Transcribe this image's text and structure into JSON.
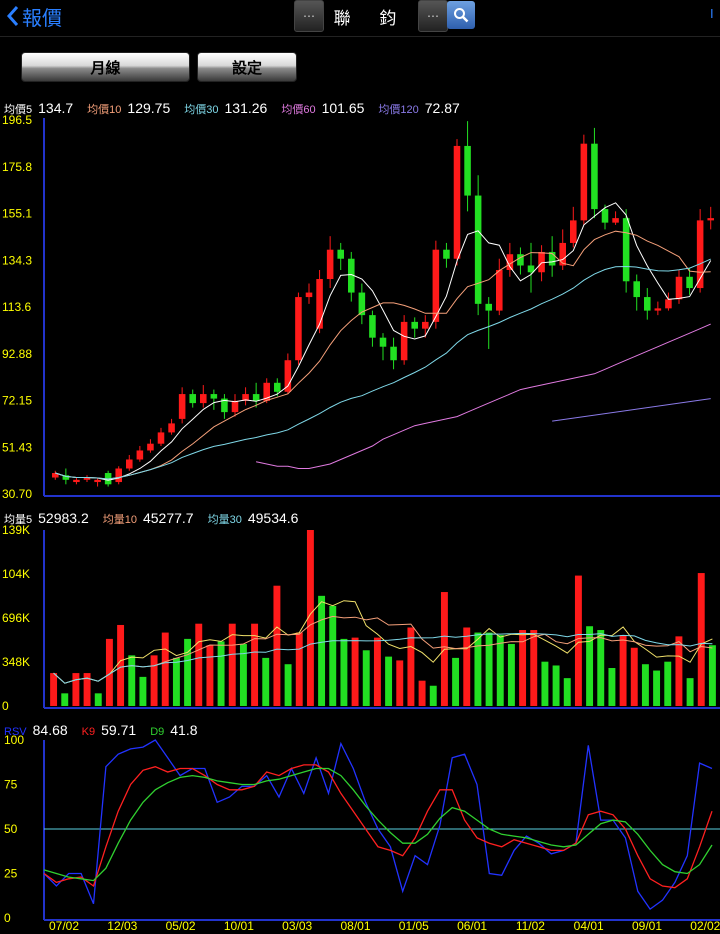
{
  "header": {
    "back_label": "報價",
    "title": "聯 鈞",
    "prev_icon": "⋯",
    "next_icon": "⋯",
    "corner_label": "I"
  },
  "buttons": {
    "period": "月線",
    "settings": "設定"
  },
  "colors": {
    "up": "#ff1a1a",
    "down": "#22e022",
    "ma5": "#ffffff",
    "ma10": "#f5a07a",
    "ma30": "#7fd8e8",
    "ma60": "#e07ae0",
    "ma120": "#8a7ae8",
    "vol5": "#f0e06a",
    "vol10": "#f5a07a",
    "vol30": "#7fd8e8",
    "rsv": "#2233ff",
    "k9": "#ff2020",
    "d9": "#30d030",
    "axis": "#2233cc",
    "tick": "#ffff00"
  },
  "price_legend": [
    {
      "label": "均價5",
      "value": "134.7",
      "color": "#ffffff"
    },
    {
      "label": "均價10",
      "value": "129.75",
      "color": "#f5a07a"
    },
    {
      "label": "均價30",
      "value": "131.26",
      "color": "#7fd8e8"
    },
    {
      "label": "均價60",
      "value": "101.65",
      "color": "#e07ae0"
    },
    {
      "label": "均價120",
      "value": "72.87",
      "color": "#8a7ae8"
    }
  ],
  "volume_legend": [
    {
      "label": "均量5",
      "value": "52983.2",
      "color": "#ffffff"
    },
    {
      "label": "均量10",
      "value": "45277.7",
      "color": "#f5a07a"
    },
    {
      "label": "均量30",
      "value": "49534.6",
      "color": "#7fd8e8"
    }
  ],
  "kd_legend": [
    {
      "label": "RSV",
      "value": "84.68",
      "color": "#2233ff"
    },
    {
      "label": "K9",
      "value": "59.71",
      "color": "#ff2020"
    },
    {
      "label": "D9",
      "value": "41.8",
      "color": "#30d030"
    }
  ],
  "chart_data": [
    {
      "type": "candlestick",
      "ylim": [
        30.7,
        196.5
      ],
      "yticks": [
        "196.5",
        "175.8",
        "155.1",
        "134.3",
        "113.6",
        "92.88",
        "72.15",
        "51.43",
        "30.70"
      ],
      "xticks": [
        "07/02",
        "12/03",
        "05/02",
        "10/01",
        "03/03",
        "08/01",
        "01/05",
        "06/01",
        "11/02",
        "04/01",
        "09/01",
        "02/02"
      ],
      "candles": [
        [
          38,
          40,
          37,
          41
        ],
        [
          39,
          37,
          35,
          42
        ],
        [
          36,
          37,
          35,
          38
        ],
        [
          37,
          38,
          36,
          39
        ],
        [
          36,
          37,
          34,
          38
        ],
        [
          40,
          35,
          34,
          41
        ],
        [
          36,
          42,
          35,
          43
        ],
        [
          42,
          46,
          41,
          48
        ],
        [
          46,
          50,
          45,
          52
        ],
        [
          50,
          53,
          49,
          55
        ],
        [
          53,
          58,
          52,
          60
        ],
        [
          58,
          62,
          57,
          64
        ],
        [
          64,
          75,
          62,
          78
        ],
        [
          75,
          71,
          69,
          77
        ],
        [
          71,
          75,
          69,
          79
        ],
        [
          75,
          73,
          68,
          77
        ],
        [
          73,
          67,
          64,
          75
        ],
        [
          67,
          72,
          65,
          75
        ],
        [
          72,
          75,
          70,
          78
        ],
        [
          75,
          72,
          69,
          80
        ],
        [
          72,
          80,
          71,
          82
        ],
        [
          80,
          76,
          74,
          82
        ],
        [
          76,
          90,
          75,
          93
        ],
        [
          90,
          118,
          88,
          120
        ],
        [
          118,
          120,
          115,
          124
        ],
        [
          104,
          126,
          102,
          130
        ],
        [
          126,
          139,
          122,
          145
        ],
        [
          139,
          135,
          130,
          142
        ],
        [
          135,
          120,
          116,
          138
        ],
        [
          120,
          110,
          106,
          124
        ],
        [
          110,
          100,
          96,
          112
        ],
        [
          100,
          96,
          90,
          102
        ],
        [
          96,
          90,
          86,
          100
        ],
        [
          90,
          107,
          88,
          110
        ],
        [
          107,
          104,
          100,
          109
        ],
        [
          104,
          107,
          100,
          110
        ],
        [
          107,
          139,
          104,
          143
        ],
        [
          139,
          135,
          131,
          142
        ],
        [
          135,
          185,
          132,
          188
        ],
        [
          185,
          163,
          156,
          196
        ],
        [
          163,
          115,
          110,
          172
        ],
        [
          115,
          112,
          95,
          118
        ],
        [
          112,
          130,
          110,
          135
        ],
        [
          130,
          137,
          127,
          142
        ],
        [
          137,
          132,
          128,
          140
        ],
        [
          132,
          129,
          120,
          142
        ],
        [
          129,
          138,
          125,
          141
        ],
        [
          138,
          132,
          127,
          145
        ],
        [
          132,
          142,
          130,
          148
        ],
        [
          142,
          152,
          140,
          158
        ],
        [
          152,
          186,
          150,
          190
        ],
        [
          186,
          157,
          153,
          193
        ],
        [
          157,
          151,
          148,
          159
        ],
        [
          151,
          153,
          150,
          156
        ],
        [
          153,
          125,
          120,
          157
        ],
        [
          125,
          118,
          112,
          128
        ],
        [
          118,
          112,
          108,
          122
        ],
        [
          112,
          113,
          110,
          116
        ],
        [
          113,
          117,
          112,
          120
        ],
        [
          117,
          127,
          115,
          130
        ],
        [
          127,
          122,
          119,
          131
        ],
        [
          122,
          152,
          120,
          157
        ],
        [
          152,
          153,
          148,
          158
        ]
      ]
    },
    {
      "type": "bar",
      "ylim": [
        0,
        139000
      ],
      "yticks": [
        "139K",
        "104K",
        "696K",
        "348K",
        "0"
      ],
      "volumes": [
        [
          26000,
          1
        ],
        [
          10000,
          0
        ],
        [
          26000,
          1
        ],
        [
          26000,
          1
        ],
        [
          10000,
          0
        ],
        [
          53000,
          1
        ],
        [
          64000,
          1
        ],
        [
          40000,
          0
        ],
        [
          23000,
          0
        ],
        [
          40000,
          1
        ],
        [
          58000,
          1
        ],
        [
          38000,
          0
        ],
        [
          53000,
          0
        ],
        [
          65000,
          1
        ],
        [
          48000,
          1
        ],
        [
          51000,
          0
        ],
        [
          65000,
          1
        ],
        [
          49000,
          0
        ],
        [
          65000,
          1
        ],
        [
          38000,
          0
        ],
        [
          95000,
          1
        ],
        [
          33000,
          0
        ],
        [
          58000,
          1
        ],
        [
          139000,
          1
        ],
        [
          87000,
          0
        ],
        [
          79000,
          0
        ],
        [
          53000,
          0
        ],
        [
          54000,
          1
        ],
        [
          44000,
          0
        ],
        [
          54000,
          1
        ],
        [
          39000,
          0
        ],
        [
          36000,
          1
        ],
        [
          62000,
          1
        ],
        [
          20000,
          1
        ],
        [
          16000,
          0
        ],
        [
          90000,
          1
        ],
        [
          38000,
          0
        ],
        [
          62000,
          1
        ],
        [
          58000,
          0
        ],
        [
          58000,
          0
        ],
        [
          56000,
          0
        ],
        [
          49000,
          0
        ],
        [
          60000,
          1
        ],
        [
          60000,
          1
        ],
        [
          35000,
          0
        ],
        [
          32000,
          0
        ],
        [
          22000,
          0
        ],
        [
          103000,
          1
        ],
        [
          63000,
          0
        ],
        [
          60000,
          0
        ],
        [
          30000,
          0
        ],
        [
          56000,
          1
        ],
        [
          46000,
          1
        ],
        [
          33000,
          0
        ],
        [
          28000,
          0
        ],
        [
          35000,
          0
        ],
        [
          55000,
          1
        ],
        [
          22000,
          0
        ],
        [
          105000,
          1
        ],
        [
          48000,
          0
        ]
      ]
    },
    {
      "type": "line",
      "ylim": [
        0,
        100
      ],
      "yticks": [
        "100",
        "75",
        "50",
        "25",
        "0"
      ],
      "series": [
        {
          "name": "RSV",
          "values": [
            25,
            18,
            25,
            25,
            8,
            85,
            92,
            95,
            96,
            100,
            90,
            80,
            84,
            84,
            65,
            68,
            74,
            74,
            80,
            68,
            84,
            70,
            90,
            70,
            98,
            84,
            65,
            50,
            40,
            15,
            35,
            30,
            52,
            90,
            92,
            75,
            25,
            24,
            38,
            46,
            42,
            36,
            38,
            42,
            97,
            55,
            55,
            45,
            15,
            5,
            10,
            20,
            35,
            87,
            84
          ]
        },
        {
          "name": "K9",
          "values": [
            25,
            20,
            22,
            23,
            18,
            40,
            60,
            75,
            83,
            85,
            82,
            84,
            84,
            80,
            75,
            72,
            72,
            74,
            82,
            80,
            84,
            86,
            86,
            82,
            70,
            60,
            50,
            40,
            38,
            35,
            45,
            60,
            72,
            72,
            55,
            45,
            42,
            40,
            44,
            42,
            40,
            38,
            38,
            42,
            58,
            60,
            58,
            50,
            35,
            22,
            18,
            17,
            22,
            40,
            60
          ]
        },
        {
          "name": "D9",
          "values": [
            27,
            25,
            23,
            22,
            21,
            28,
            42,
            55,
            65,
            72,
            76,
            79,
            80,
            79,
            77,
            76,
            75,
            75,
            77,
            78,
            80,
            82,
            84,
            84,
            80,
            72,
            63,
            55,
            48,
            42,
            42,
            47,
            56,
            62,
            60,
            55,
            50,
            47,
            46,
            45,
            43,
            41,
            40,
            41,
            47,
            53,
            55,
            54,
            47,
            38,
            30,
            26,
            25,
            30,
            41
          ]
        }
      ],
      "reference_line": 50
    }
  ]
}
